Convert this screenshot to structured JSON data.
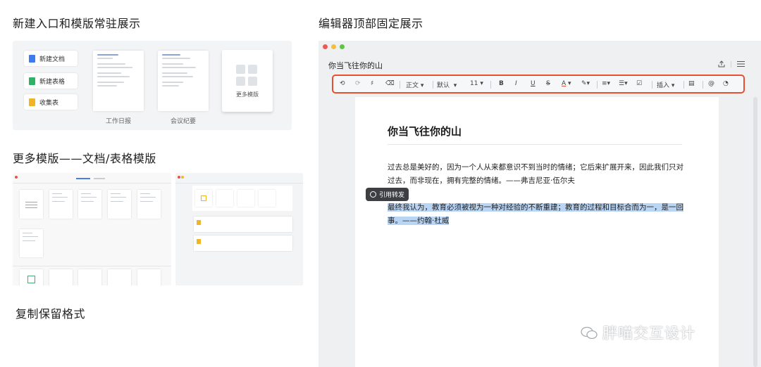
{
  "sections": {
    "s1": "新建入口和模版常驻展示",
    "s2": "更多模版——文档/表格模版",
    "s3": "复制保留格式",
    "s4": "编辑器顶部固定展示"
  },
  "panel1": {
    "new_doc": "新建文档",
    "new_sheet": "新建表格",
    "collect": "收集表",
    "templates": [
      "工作日报",
      "会议纪要"
    ],
    "more_templates": "更多模版"
  },
  "editor": {
    "window_title": "你当飞往你的山",
    "toolbar": {
      "style": "正文",
      "font": "默认",
      "size": "11",
      "bold": "B",
      "italic": "I",
      "underline": "U",
      "strike": "S",
      "color": "A",
      "insert": "插入"
    },
    "doc_title": "你当飞往你的山",
    "para1": " 过去总是美好的，因为一个人从来都意识不到当时的情绪；它后来扩展开来，因此我们只对过去，而非现在，拥有完整的情绪。——弗吉尼亚·伍尔夫",
    "para2": "最终我认为，教育必须被视为一种对经验的不断重建；教育的过程和目标合而为一，是一回事。——约翰·杜威",
    "quote_tip": "引用转发"
  },
  "watermark": "胖喵交互设计",
  "colors": {
    "highlight_border": "#e8502e",
    "selection": "#b9d5f5",
    "doc_icon": "#3b7cf0",
    "sheet_icon": "#2fb264",
    "collect_icon": "#f0b429"
  }
}
